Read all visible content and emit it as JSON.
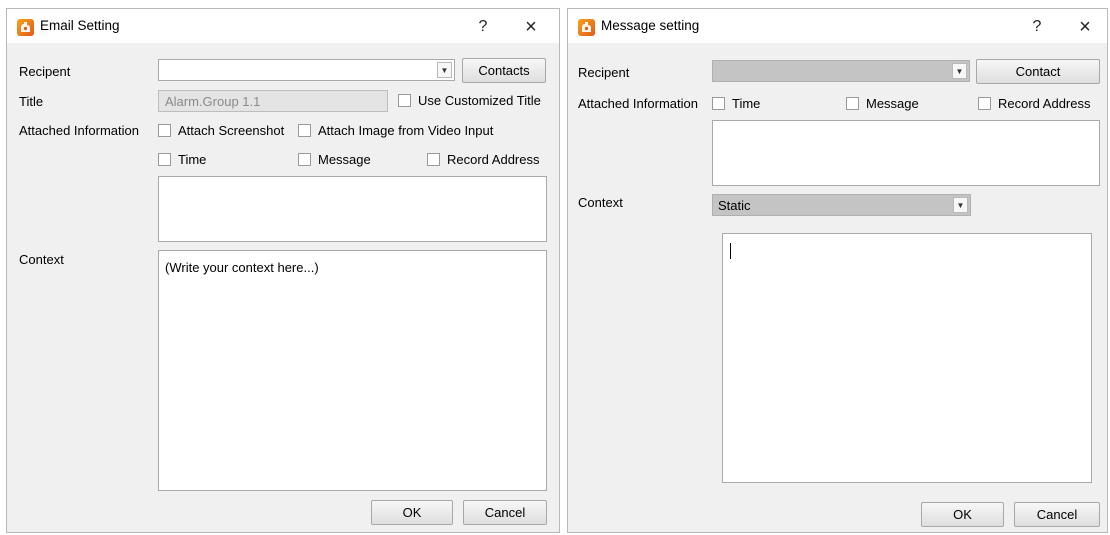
{
  "email_dialog": {
    "title": "Email Setting",
    "help_glyph": "?",
    "close_glyph": "×",
    "recipient_label": "Recipent",
    "recipient_value": "",
    "contacts_button": "Contacts",
    "title_label": "Title",
    "title_value": "Alarm.Group 1.1",
    "use_customized_title": "Use Customized Title",
    "attached_info_label": "Attached Information",
    "attach_screenshot": "Attach Screenshot",
    "attach_image_video": "Attach Image from Video Input",
    "time": "Time",
    "message": "Message",
    "record_address": "Record Address",
    "info_text": "",
    "context_label": "Context",
    "context_placeholder": "(Write your context here...)",
    "ok_button": "OK",
    "cancel_button": "Cancel"
  },
  "message_dialog": {
    "title": "Message setting",
    "help_glyph": "?",
    "close_glyph": "×",
    "recipient_label": "Recipent",
    "recipient_value": "",
    "contact_button": "Contact",
    "attached_info_label": "Attached Information",
    "time": "Time",
    "message": "Message",
    "record_address": "Record Address",
    "info_text": "",
    "context_label": "Context",
    "context_value": "Static",
    "context_text": "",
    "ok_button": "OK",
    "cancel_button": "Cancel"
  },
  "icons": {
    "app": "app-logo-icon",
    "help": "help-icon",
    "close": "close-icon",
    "dropdown": "chevron-down-icon"
  },
  "colors": {
    "dialog_bg": "#f0f0f0",
    "titlebar_bg": "#ffffff",
    "app_icon": "#e8701a",
    "disabled_combo": "#c4c4c4"
  }
}
